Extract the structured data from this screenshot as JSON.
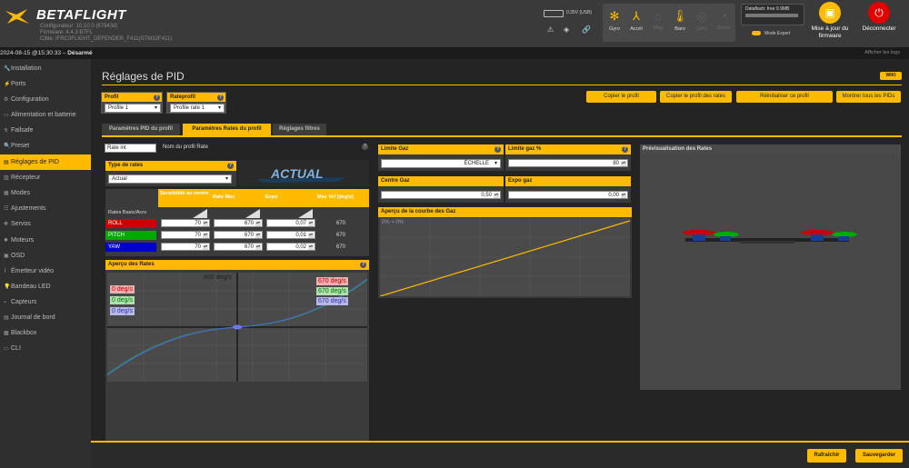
{
  "header": {
    "brand": "BETAFLIGHT",
    "configurator": "Configurateur: 10.10.0 (67943d)",
    "firmware": "Firmware: 4.4.3 BTFL",
    "target": "Cible: IFRC/IFLIGHT_DEFENDER_F411(STM32F411)",
    "battery_voltage": "0.35V (USB)",
    "sensors": [
      {
        "label": "Gyro",
        "icon": "gyro-icon",
        "active": true
      },
      {
        "label": "Accél",
        "icon": "accel-icon",
        "active": true
      },
      {
        "label": "Mag",
        "icon": "mag-icon",
        "active": false
      },
      {
        "label": "Baro",
        "icon": "baro-icon",
        "active": true
      },
      {
        "label": "GPS",
        "icon": "gps-icon",
        "active": false
      },
      {
        "label": "Sonar",
        "icon": "sonar-icon",
        "active": false
      }
    ],
    "dataflash": "Dataflash: free 9.9MB",
    "expert_mode": "Mode Expert",
    "update_firmware": "Mise à jour du firmware",
    "disconnect": "Déconnecter",
    "accent": "#ffbb00",
    "disconnect_color": "#e00000"
  },
  "statusbar": {
    "datetime": "2024-08-15 @15:30:33",
    "arming": "Désarmé",
    "show_logs": "Afficher les logs"
  },
  "sidebar": {
    "items": [
      {
        "label": "Installation",
        "icon": "wrench-icon",
        "active": false
      },
      {
        "label": "Ports",
        "icon": "plug-icon",
        "active": false
      },
      {
        "label": "Configuration",
        "icon": "gear-icon",
        "active": false
      },
      {
        "label": "Alimentation et batterie",
        "icon": "battery-icon",
        "active": false
      },
      {
        "label": "Failsafe",
        "icon": "failsafe-icon",
        "active": false
      },
      {
        "label": "Preset",
        "icon": "search-icon",
        "active": false
      },
      {
        "label": "Réglages de PID",
        "icon": "pid-icon",
        "active": true
      },
      {
        "label": "Récepteur",
        "icon": "receiver-icon",
        "active": false
      },
      {
        "label": "Modes",
        "icon": "modes-icon",
        "active": false
      },
      {
        "label": "Ajustements",
        "icon": "sliders-icon",
        "active": false
      },
      {
        "label": "Servos",
        "icon": "servo-icon",
        "active": false
      },
      {
        "label": "Moteurs",
        "icon": "motor-icon",
        "active": false
      },
      {
        "label": "OSD",
        "icon": "osd-icon",
        "active": false
      },
      {
        "label": "Émetteur vidéo",
        "icon": "vtx-icon",
        "active": false
      },
      {
        "label": "Bandeau LED",
        "icon": "led-icon",
        "active": false
      },
      {
        "label": "Capteurs",
        "icon": "sensors-icon",
        "active": false
      },
      {
        "label": "Journal de bord",
        "icon": "log-icon",
        "active": false
      },
      {
        "label": "Blackbox",
        "icon": "blackbox-icon",
        "active": false
      },
      {
        "label": "CLI",
        "icon": "terminal-icon",
        "active": false
      }
    ]
  },
  "main": {
    "title": "Réglages de PID",
    "wiki": "WIKI",
    "profile": {
      "label": "Profil",
      "value": "Profile 1"
    },
    "rateprofile": {
      "label": "Rateprofil",
      "value": "Profile rate 1"
    },
    "actions": {
      "copy_profile": "Copier le profil",
      "copy_rates": "Copier le profil des rates",
      "reset_profile": "Réinitialiser ce profil",
      "show_all": "Montrer tous les PIDs"
    },
    "tabs": [
      "Paramètres PID du profil",
      "Paramètres Rates du profil",
      "Réglages filtres"
    ],
    "rate_name": {
      "value": "Rate int",
      "label": "Nom du profil Rate"
    },
    "rates_type": {
      "label": "Type de rates",
      "value": "Actual",
      "logo": "ACTUAL"
    },
    "rates_table": {
      "headers": [
        "Sensibilité au centre",
        "Rate Max",
        "Expo",
        "Max Vel [deg/s]"
      ],
      "section": "Rates Basic/Acro",
      "rows": [
        {
          "axis": "ROLL",
          "color": "#cc0000",
          "center": "70",
          "max": "670",
          "expo": "0,07",
          "maxvel": "670"
        },
        {
          "axis": "PITCH",
          "color": "#00aa00",
          "center": "70",
          "max": "670",
          "expo": "0,01",
          "maxvel": "670"
        },
        {
          "axis": "YAW",
          "color": "#0000cc",
          "center": "70",
          "max": "670",
          "expo": "0,02",
          "maxvel": "670"
        }
      ]
    },
    "rates_preview": {
      "title": "Aperçu des Rates",
      "top": "800 deg/s",
      "left": [
        "0 deg/s",
        "0 deg/s",
        "0 deg/s"
      ],
      "right": [
        "670 deg/s",
        "670 deg/s",
        "670 deg/s"
      ]
    },
    "throttle": {
      "limit_label": "Limite Gaz",
      "limit_value": "ÉCHELLE",
      "limit_pct_label": "Limite gaz %",
      "limit_pct_value": "80",
      "mid_label": "Centre Gaz",
      "mid_value": "0,50",
      "expo_label": "Expo gaz",
      "expo_value": "0,00",
      "curve_title": "Aperçu de la courbe des Gaz",
      "curve_readout": "0% = 0%"
    },
    "preview_title": "Prévisualisation des Rates"
  },
  "footer": {
    "refresh": "Rafraîchir",
    "save": "Sauvegarder"
  }
}
